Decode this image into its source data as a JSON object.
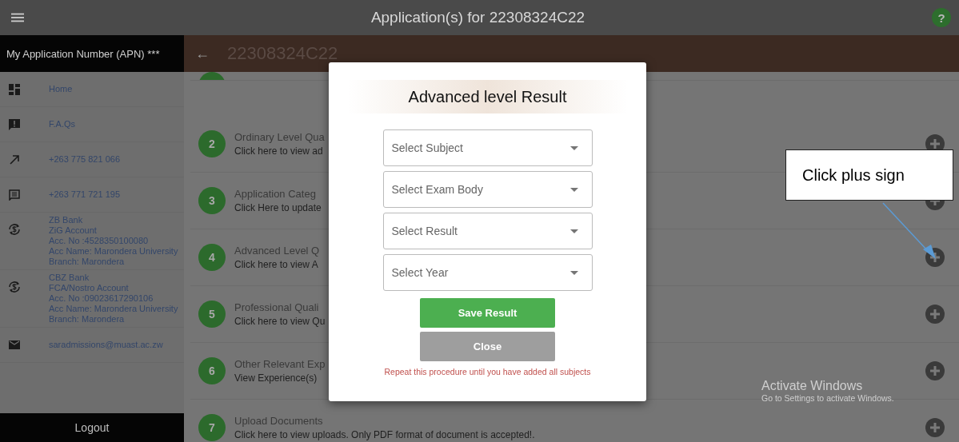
{
  "top_bar": {
    "title": "Application(s) for 22308324C22",
    "help_icon": "?"
  },
  "sidebar": {
    "header": "My Application Number (APN) ***",
    "items": [
      {
        "kind": "dashboard",
        "lines": [
          "Home"
        ]
      },
      {
        "kind": "faq",
        "lines": [
          "F.A.Qs"
        ]
      },
      {
        "kind": "arrow",
        "lines": [
          "+263 775 821 066"
        ]
      },
      {
        "kind": "message",
        "lines": [
          "+263 771 721 195"
        ]
      },
      {
        "kind": "bank",
        "lines": [
          "ZB Bank",
          "ZiG Account",
          "Acc. No :4528350100080",
          "Acc Name: Marondera University",
          "Branch: Marondera"
        ]
      },
      {
        "kind": "bank",
        "lines": [
          "CBZ Bank",
          "FCA/Nostro Account",
          "Acc. No :09023617290106",
          "Acc Name: Marondera University",
          "Branch: Marondera"
        ]
      },
      {
        "kind": "mail",
        "lines": [
          "saradmissions@muast.ac.zw"
        ]
      }
    ],
    "logout": "Logout"
  },
  "header": {
    "back": "←",
    "apn": "22308324C22"
  },
  "steps": [
    {
      "kind": "partial"
    },
    {
      "number": "2",
      "title": "Ordinary Level Qua",
      "subtitle": "Click here to view ad"
    },
    {
      "number": "3",
      "title": "Application Categ",
      "subtitle": "Click Here to update"
    },
    {
      "number": "4",
      "title": "Advanced Level Q",
      "subtitle": "Click here to view  A"
    },
    {
      "number": "5",
      "title": "Professional Quali",
      "subtitle": "Click here to view Qu"
    },
    {
      "number": "6",
      "title": "Other Relevant Exp",
      "subtitle": "View Experience(s)"
    },
    {
      "number": "7",
      "title": "Upload Documents",
      "subtitle": "Click here to view uploads. Only PDF format of document is accepted!."
    }
  ],
  "dialog": {
    "title": "Advanced level Result",
    "fields": [
      {
        "placeholder": "Select Subject"
      },
      {
        "placeholder": "Select Exam Body"
      },
      {
        "placeholder": "Select Result"
      },
      {
        "placeholder": "Select Year"
      }
    ],
    "save": "Save Result",
    "close": "Close",
    "note": "Repeat this procedure until you have added all subjects"
  },
  "callout": {
    "text": "Click plus sign"
  },
  "os_notice": {
    "title": "Activate Windows",
    "subtitle": "Go to Settings to activate Windows."
  }
}
